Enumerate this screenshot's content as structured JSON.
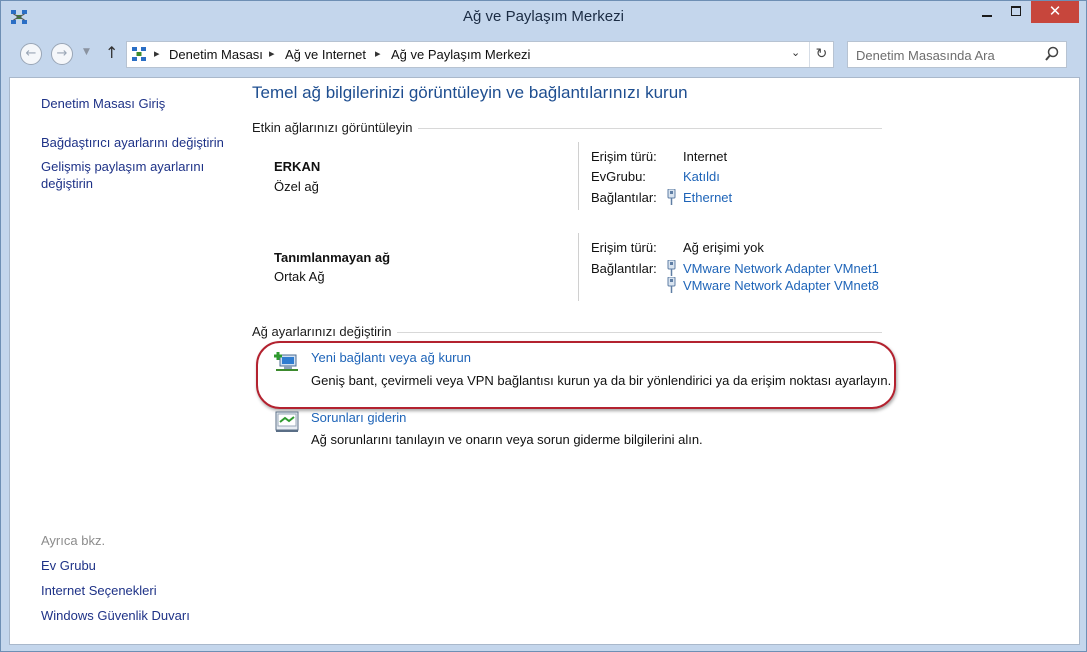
{
  "window": {
    "title": "Ağ ve Paylaşım Merkezi"
  },
  "toolbar": {
    "breadcrumb": [
      "Denetim Masası",
      "Ağ ve Internet",
      "Ağ ve Paylaşım Merkezi"
    ],
    "search_placeholder": "Denetim Masasında Ara"
  },
  "sidebar": {
    "links": [
      "Denetim Masası Giriş",
      "Bağdaştırıcı ayarlarını değiştirin",
      "Gelişmiş paylaşım ayarlarını değiştirin"
    ],
    "see_also_heading": "Ayrıca bkz.",
    "see_also": [
      "Ev Grubu",
      "Internet Seçenekleri",
      "Windows Güvenlik Duvarı"
    ]
  },
  "main": {
    "title": "Temel ağ bilgilerinizi görüntüleyin ve bağlantılarınızı kurun",
    "active_networks_label": "Etkin ağlarınızı görüntüleyin",
    "networks": [
      {
        "name": "ERKAN",
        "type": "Özel ağ",
        "access_label": "Erişim türü:",
        "access_value": "Internet",
        "homegroup_label": "EvGrubu:",
        "homegroup_value": "Katıldı",
        "connections_label": "Bağlantılar:",
        "connections": [
          "Ethernet"
        ]
      },
      {
        "name": "Tanımlanmayan ağ",
        "type": "Ortak Ağ",
        "access_label": "Erişim türü:",
        "access_value": "Ağ erişimi yok",
        "connections_label": "Bağlantılar:",
        "connections": [
          "VMware Network Adapter VMnet1",
          "VMware Network Adapter VMnet8"
        ]
      }
    ],
    "change_settings_label": "Ağ ayarlarınızı değiştirin",
    "tasks": [
      {
        "title": "Yeni bağlantı veya ağ kurun",
        "description": "Geniş bant, çevirmeli veya VPN bağlantısı kurun ya da bir yönlendirici ya da erişim noktası ayarlayın."
      },
      {
        "title": "Sorunları giderin",
        "description": "Ağ sorunlarını tanılayın ve onarın veya sorun giderme bilgilerini alın."
      }
    ]
  },
  "colors": {
    "link": "#1e64b8",
    "title": "#1e4e90",
    "highlight": "#b3222f",
    "chrome": "#c4d6ec"
  },
  "icons": [
    "network-center-icon",
    "back-arrow-icon",
    "forward-arrow-icon",
    "up-arrow-icon",
    "control-panel-icon",
    "refresh-icon",
    "search-icon",
    "ethernet-icon",
    "new-connection-icon",
    "troubleshoot-icon"
  ]
}
